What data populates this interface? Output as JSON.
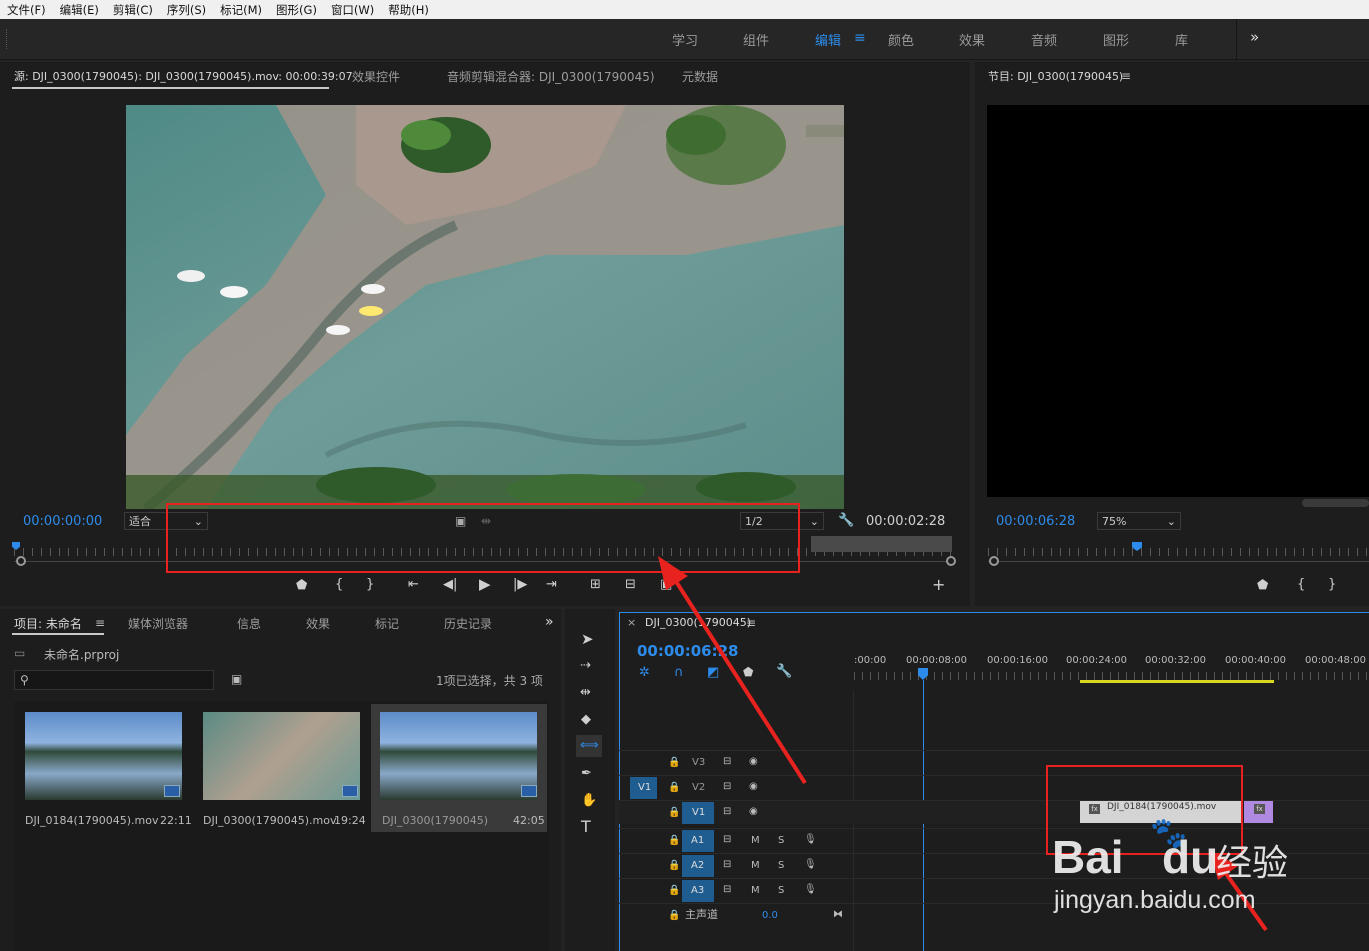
{
  "menu": [
    "文件(F)",
    "编辑(E)",
    "剪辑(C)",
    "序列(S)",
    "标记(M)",
    "图形(G)",
    "窗口(W)",
    "帮助(H)"
  ],
  "workspaces": [
    "学习",
    "组件",
    "编辑",
    "颜色",
    "效果",
    "音频",
    "图形",
    "库"
  ],
  "source": {
    "tab": "源: DJI_0300(1790045): DJI_0300(1790045).mov: 00:00:39:07",
    "tab2": "效果控件",
    "tab3": "音频剪辑混合器: DJI_0300(1790045)",
    "tab4": "元数据",
    "timecode": "00:00:00:00",
    "fit": "适合",
    "res": "1/2",
    "duration": "00:00:02:28"
  },
  "program": {
    "tab": "节目: DJI_0300(1790045)",
    "timecode": "00:00:06:28",
    "zoom": "75%"
  },
  "project": {
    "tabs": [
      "项目: 未命名",
      "媒体浏览器",
      "信息",
      "效果",
      "标记",
      "历史记录"
    ],
    "file": "未命名.prproj",
    "status": "1项已选择，共 3 项",
    "clips": [
      {
        "name": "DJI_0184(1790045).mov",
        "dur": "22:11"
      },
      {
        "name": "DJI_0300(1790045).mov",
        "dur": "19:24"
      },
      {
        "name": "DJI_0300(1790045)",
        "dur": "42:05"
      }
    ]
  },
  "timeline": {
    "title": "DJI_0300(1790045)",
    "timecode": "00:00:06:28",
    "ruler": [
      ":00:00",
      "00:00:08:00",
      "00:00:16:00",
      "00:00:24:00",
      "00:00:32:00",
      "00:00:40:00",
      "00:00:48:00"
    ],
    "tracks": [
      "V3",
      "V2",
      "V1",
      "A1",
      "A2",
      "A3"
    ],
    "v1_src": "V1",
    "master": "主声道",
    "master_val": "0.0",
    "clip": "DJI_0184(1790045).mov",
    "fx": "fx"
  },
  "watermark": {
    "brand": "Bai",
    "brand2": "du",
    "cn": "经验",
    "url": "jingyan.baidu.com"
  }
}
